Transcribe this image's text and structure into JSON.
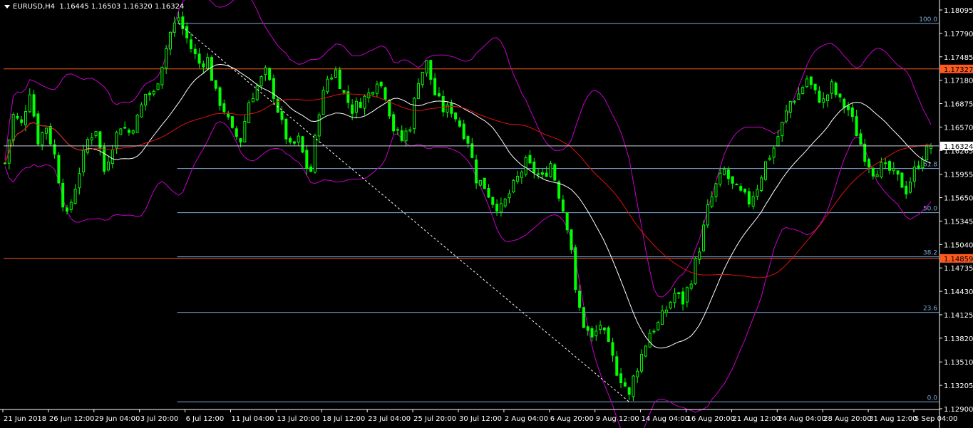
{
  "header": {
    "symbol": "EURUSD,H4",
    "ohlc": "1.16445 1.16503 1.16320 1.16324"
  },
  "colors": {
    "background": "#000000",
    "candle": "#00ff00",
    "bollinger": "#c800c8",
    "ma_fast": "#ffffff",
    "ma_slow": "#e01010",
    "fib": "#7fa9d6",
    "hline": "#ff5a1e",
    "bid": "#c8d2dc"
  },
  "chart_data": {
    "type": "candlestick",
    "symbol": "EURUSD",
    "timeframe": "H4",
    "ylim": [
      1.129,
      1.18095
    ],
    "y_ticks": [
      "1.18095",
      "1.17790",
      "1.17485",
      "1.17180",
      "1.16875",
      "1.16570",
      "1.16265",
      "1.15955",
      "1.15650",
      "1.15345",
      "1.15040",
      "1.14735",
      "1.14430",
      "1.14125",
      "1.13820",
      "1.13510",
      "1.13205",
      "1.12900"
    ],
    "x_ticks": [
      "21 Jun 2018",
      "26 Jun 12:00",
      "29 Jun 04:00",
      "3 Jul 20:00",
      "6 Jul 12:00",
      "11 Jul 04:00",
      "13 Jul 20:00",
      "18 Jul 12:00",
      "23 Jul 04:00",
      "25 Jul 20:00",
      "30 Jul 12:00",
      "2 Aug 04:00",
      "6 Aug 20:00",
      "9 Aug 12:00",
      "14 Aug 04:00",
      "16 Aug 20:00",
      "21 Aug 12:00",
      "24 Aug 04:00",
      "28 Aug 20:00",
      "31 Aug 12:00",
      "5 Sep 04:00"
    ],
    "price_path": [
      [
        0,
        1.161
      ],
      [
        2,
        1.1672
      ],
      [
        4,
        1.166
      ],
      [
        6,
        1.1705
      ],
      [
        8,
        1.164
      ],
      [
        10,
        1.1658
      ],
      [
        12,
        1.162
      ],
      [
        14,
        1.156
      ],
      [
        15,
        1.154
      ],
      [
        17,
        1.158
      ],
      [
        20,
        1.164
      ],
      [
        22,
        1.1655
      ],
      [
        24,
        1.16
      ],
      [
        26,
        1.1635
      ],
      [
        28,
        1.166
      ],
      [
        30,
        1.165
      ],
      [
        32,
        1.1668
      ],
      [
        34,
        1.17
      ],
      [
        36,
        1.17
      ],
      [
        38,
        1.174
      ],
      [
        40,
        1.178
      ],
      [
        42,
        1.18
      ],
      [
        43,
        1.1785
      ],
      [
        45,
        1.176
      ],
      [
        47,
        1.174
      ],
      [
        49,
        1.1745
      ],
      [
        51,
        1.17
      ],
      [
        53,
        1.168
      ],
      [
        55,
        1.165
      ],
      [
        57,
        1.164
      ],
      [
        59,
        1.169
      ],
      [
        61,
        1.171
      ],
      [
        63,
        1.1728
      ],
      [
        65,
        1.17
      ],
      [
        67,
        1.166
      ],
      [
        69,
        1.163
      ],
      [
        71,
        1.164
      ],
      [
        73,
        1.1605
      ],
      [
        74,
        1.16
      ],
      [
        76,
        1.168
      ],
      [
        78,
        1.172
      ],
      [
        80,
        1.173
      ],
      [
        82,
        1.17
      ],
      [
        84,
        1.168
      ],
      [
        86,
        1.169
      ],
      [
        88,
        1.17
      ],
      [
        90,
        1.172
      ],
      [
        92,
        1.17
      ],
      [
        94,
        1.1655
      ],
      [
        96,
        1.164
      ],
      [
        98,
        1.166
      ],
      [
        100,
        1.172
      ],
      [
        102,
        1.174
      ],
      [
        104,
        1.17
      ],
      [
        106,
        1.168
      ],
      [
        108,
        1.168
      ],
      [
        110,
        1.166
      ],
      [
        112,
        1.164
      ],
      [
        114,
        1.159
      ],
      [
        116,
        1.158
      ],
      [
        118,
        1.156
      ],
      [
        120,
        1.155
      ],
      [
        122,
        1.157
      ],
      [
        124,
        1.159
      ],
      [
        126,
        1.161
      ],
      [
        128,
        1.16
      ],
      [
        130,
        1.159
      ],
      [
        132,
        1.161
      ],
      [
        134,
        1.157
      ],
      [
        136,
        1.153
      ],
      [
        137,
        1.15
      ],
      [
        138,
        1.144
      ],
      [
        140,
        1.14
      ],
      [
        142,
        1.138
      ],
      [
        144,
        1.14
      ],
      [
        146,
        1.137
      ],
      [
        148,
        1.134
      ],
      [
        150,
        1.132
      ],
      [
        151,
        1.1305
      ],
      [
        152,
        1.133
      ],
      [
        154,
        1.136
      ],
      [
        156,
        1.139
      ],
      [
        158,
        1.14
      ],
      [
        160,
        1.142
      ],
      [
        162,
        1.144
      ],
      [
        164,
        1.143
      ],
      [
        166,
        1.146
      ],
      [
        168,
        1.15
      ],
      [
        170,
        1.155
      ],
      [
        172,
        1.158
      ],
      [
        174,
        1.16
      ],
      [
        176,
        1.158
      ],
      [
        178,
        1.157
      ],
      [
        180,
        1.156
      ],
      [
        182,
        1.158
      ],
      [
        184,
        1.161
      ],
      [
        186,
        1.163
      ],
      [
        188,
        1.166
      ],
      [
        190,
        1.169
      ],
      [
        192,
        1.17
      ],
      [
        194,
        1.172
      ],
      [
        196,
        1.17
      ],
      [
        198,
        1.169
      ],
      [
        200,
        1.171
      ],
      [
        202,
        1.169
      ],
      [
        204,
        1.168
      ],
      [
        206,
        1.165
      ],
      [
        208,
        1.162
      ],
      [
        210,
        1.16
      ],
      [
        212,
        1.1605
      ],
      [
        214,
        1.16
      ],
      [
        216,
        1.159
      ],
      [
        218,
        1.1575
      ],
      [
        220,
        1.16
      ],
      [
        222,
        1.162
      ],
      [
        224,
        1.1632
      ]
    ],
    "moving_averages": [
      {
        "name": "fast",
        "color": "#ffffff",
        "period": 20
      },
      {
        "name": "slow",
        "color": "#e01010",
        "period": 50
      }
    ],
    "bollinger": {
      "period": 20,
      "deviation": 2,
      "color": "#c800c8"
    },
    "fibonacci": {
      "high": 1.1792,
      "low": 1.1299,
      "levels": [
        {
          "label": "100.0",
          "value": 1.1792
        },
        {
          "label": "61.8",
          "value": 1.1603
        },
        {
          "label": "50.0",
          "value": 1.15455
        },
        {
          "label": "38.2",
          "value": 1.1488
        },
        {
          "label": "23.6",
          "value": 1.14155
        },
        {
          "label": "0.0",
          "value": 1.1299
        }
      ]
    },
    "horizontal_lines": [
      {
        "label": "1.17327",
        "value": 1.17327,
        "color": "#ff5a1e"
      },
      {
        "label": "1.14859",
        "value": 1.14859,
        "color": "#ff5a1e"
      }
    ],
    "bid": {
      "label": "1.16324",
      "value": 1.16324
    }
  }
}
